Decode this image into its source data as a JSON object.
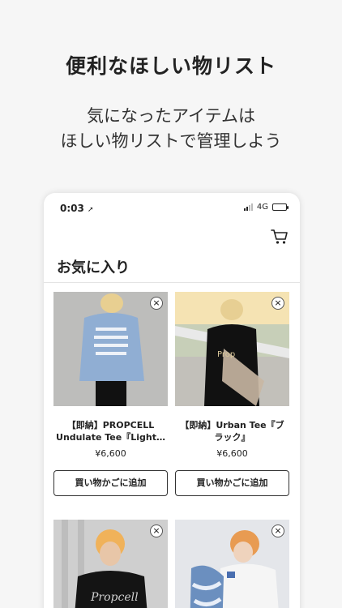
{
  "hero": {
    "title": "便利なほしい物リスト",
    "subtitle_line1": "気になったアイテムは",
    "subtitle_line2": "ほしい物リストで管理しよう"
  },
  "status": {
    "time": "0:03",
    "network": "4G"
  },
  "screen": {
    "title": "お気に入り",
    "cart_icon": "cart-icon"
  },
  "items": [
    {
      "name_line1": "【即納】PROPCELL",
      "name_line2": "Undulate Tee『Light…",
      "price": "¥6,600",
      "add_label": "買い物かごに追加",
      "remove_label": "×"
    },
    {
      "name_line1": "【即納】Urban Tee『ブ",
      "name_line2": "ラック』",
      "price": "¥6,600",
      "add_label": "買い物かごに追加",
      "remove_label": "×"
    },
    {
      "remove_label": "×"
    },
    {
      "remove_label": "×"
    }
  ]
}
